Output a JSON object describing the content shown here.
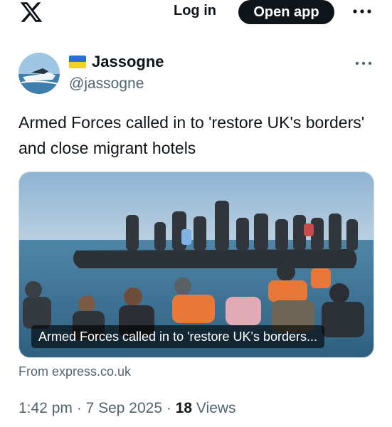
{
  "header": {
    "logo_icon": "x-logo-icon",
    "login_label": "Log in",
    "open_app_label": "Open app",
    "more_icon": "more-horizontal-icon"
  },
  "post": {
    "display_name": "Jassogne",
    "handle": "@jassogne",
    "flag_icon": "ukraine-flag-icon",
    "text": "Armed Forces called in to 'restore UK's borders' and close migrant hotels",
    "card": {
      "caption": "Armed Forces called in to 'restore UK's borders...",
      "source": "From express.co.uk"
    },
    "time": "1:42 pm",
    "separator": "·",
    "date": "7 Sep 2025",
    "views_count": "18",
    "views_label": "Views"
  },
  "colors": {
    "text_primary": "#0f1419",
    "text_secondary": "#536471",
    "flag_blue": "#2b6fd6",
    "flag_yellow": "#f4d21f"
  }
}
